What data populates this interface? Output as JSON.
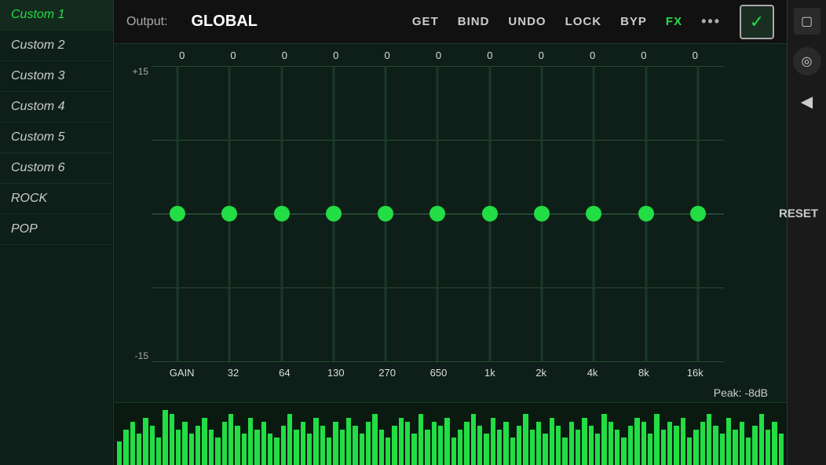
{
  "header": {
    "output_label": "Output:",
    "output_value": "GLOBAL",
    "get_label": "GET",
    "bind_label": "BIND",
    "undo_label": "UNDO",
    "lock_label": "LOCK",
    "byp_label": "BYP",
    "fx_label": "FX",
    "dots_label": "•••",
    "check_label": "✓"
  },
  "sidebar": {
    "items": [
      {
        "label": "Custom 1",
        "active": true
      },
      {
        "label": "Custom 2",
        "active": false
      },
      {
        "label": "Custom 3",
        "active": false
      },
      {
        "label": "Custom 4",
        "active": false
      },
      {
        "label": "Custom 5",
        "active": false
      },
      {
        "label": "Custom 6",
        "active": false
      },
      {
        "label": "ROCK",
        "active": false
      },
      {
        "label": "POP",
        "active": false
      }
    ]
  },
  "eq": {
    "db_top": "+15",
    "db_mid": "",
    "db_bottom": "-15",
    "reset_label": "RESET",
    "bands": [
      {
        "label": "GAIN",
        "value": "0"
      },
      {
        "label": "32",
        "value": "0"
      },
      {
        "label": "64",
        "value": "0"
      },
      {
        "label": "130",
        "value": "0"
      },
      {
        "label": "270",
        "value": "0"
      },
      {
        "label": "650",
        "value": "0"
      },
      {
        "label": "1k",
        "value": "0"
      },
      {
        "label": "2k",
        "value": "0"
      },
      {
        "label": "4k",
        "value": "0"
      },
      {
        "label": "8k",
        "value": "0"
      },
      {
        "label": "16k",
        "value": "0"
      }
    ],
    "peak": "Peak: -8dB"
  },
  "spectrum": {
    "bars": [
      30,
      45,
      55,
      40,
      60,
      50,
      35,
      70,
      65,
      45,
      55,
      40,
      50,
      60,
      45,
      35,
      55,
      65,
      50,
      40,
      60,
      45,
      55,
      40,
      35,
      50,
      65,
      45,
      55,
      40,
      60,
      50,
      35,
      55,
      45,
      60,
      50,
      40,
      55,
      65,
      45,
      35,
      50,
      60,
      55,
      40,
      65,
      45,
      55,
      50,
      60,
      35,
      45,
      55,
      65,
      50,
      40,
      60,
      45,
      55,
      35,
      50,
      65,
      45,
      55,
      40,
      60,
      50,
      35,
      55,
      45,
      60,
      50,
      40,
      65,
      55,
      45,
      35,
      50,
      60,
      55,
      40,
      65,
      45,
      55,
      50,
      60,
      35,
      45,
      55,
      65,
      50,
      40,
      60,
      45,
      55,
      35,
      50,
      65,
      45,
      55,
      40
    ]
  },
  "right_panel": {
    "square_icon": "□",
    "circle_icon": "○",
    "triangle_icon": "◀"
  }
}
